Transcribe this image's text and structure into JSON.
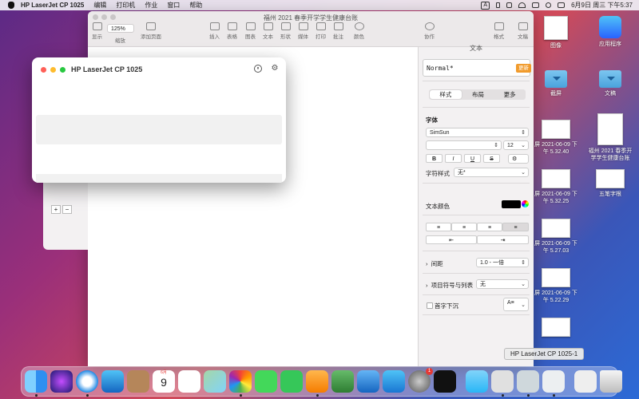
{
  "menubar": {
    "app_name": "HP LaserJet CP 1025",
    "items": [
      "编辑",
      "打印机",
      "作业",
      "窗口",
      "帮助"
    ],
    "input_method": "A",
    "datetime": "6月9日 周三 下午5:37"
  },
  "pages": {
    "doc_title": "福州 2021 春季开学学生健康台账",
    "zoom": "125%",
    "toolbar_left": [
      "显示",
      "缩放",
      "添加页面"
    ],
    "toolbar_mid": [
      "插入",
      "表格",
      "图表",
      "文本",
      "形状",
      "媒体",
      "打印",
      "批注",
      "颜色"
    ],
    "toolbar_right": [
      "协作",
      "格式",
      "文稿"
    ],
    "panel": {
      "header": "文本",
      "para_style": "Normal*",
      "update": "更新",
      "tabs": [
        "样式",
        "布局",
        "更多"
      ],
      "font_label": "字体",
      "font_name": "SimSun",
      "font_size": "12",
      "format_buttons": [
        "B",
        "I",
        "U",
        "S"
      ],
      "char_style_label": "字符样式",
      "char_style_value": "无*",
      "text_color_label": "文本颜色",
      "spacing_label": "间距",
      "spacing_value": "1.0 - 一倍",
      "bullets_label": "项目符号与列表",
      "bullets_value": "无",
      "dropcap_label": "首字下沉",
      "text_color": "#000000",
      "accent": "#f19b2c"
    }
  },
  "hp_window": {
    "title": "HP LaserJet CP 1025"
  },
  "desktop": {
    "icons": [
      {
        "label": "图像"
      },
      {
        "label": "应用程序"
      },
      {
        "label": "截屏"
      },
      {
        "label": "文稿"
      },
      {
        "label": "屏 2021-06-09 下午 5.32.40"
      },
      {
        "label": "福州 2021 春季开学学生健康台账"
      },
      {
        "label": "屏 2021-06-09 下午 5.32.25"
      },
      {
        "label": "五笔字根"
      },
      {
        "label": "屏 2021-06-09 下午 5.27.03"
      },
      {
        "label": "屏 2021-06-09 下午 5.22.29"
      }
    ]
  },
  "dock": {
    "tooltip": "HP LaserJet CP 1025-1",
    "calendar_month": "6月",
    "calendar_day": "9",
    "badge_count": "1",
    "apps": [
      "finder",
      "siri",
      "safari",
      "mail",
      "contacts",
      "calendar",
      "reminders",
      "maps",
      "photos",
      "messages",
      "facetime",
      "pages",
      "numbers",
      "keynote",
      "app-store",
      "system-preferences",
      "apple-tv"
    ]
  }
}
